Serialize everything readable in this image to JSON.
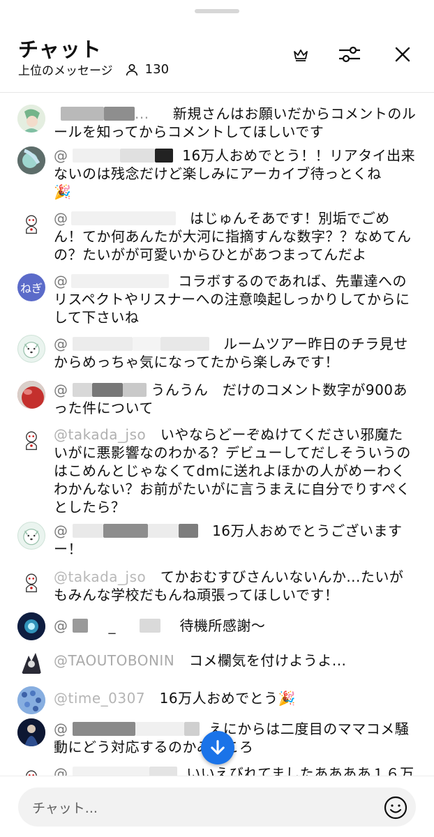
{
  "header": {
    "title": "チャット",
    "sort_label": "上位のメッセージ",
    "viewer_count": "130"
  },
  "icons": {
    "crown": "crown-icon",
    "tune": "tune-icon",
    "close": "close-icon",
    "person": "person-icon",
    "arrow_down": "arrow-down-icon",
    "emoji": "smiley-icon"
  },
  "colors": {
    "accent": "#1a73e8",
    "avatar_negi": "#5b6bc9"
  },
  "messages": [
    {
      "author": "",
      "text": "新規さんはお願いだからコメントのルールを知ってからコメントしてほしいです"
    },
    {
      "author": "@",
      "text": "16万人おめでとう！！リアタイ出来ないのは残念だけど楽しみにアーカイブ待っとくね",
      "emoji": "🎉"
    },
    {
      "author": "@",
      "text": "はじゅんそあです！別垢でごめん！てか何あんたが大河に指摘すんな数字？？なめてんの？たいがが可愛いからひとがあつまってんだよ"
    },
    {
      "author": "@",
      "avatar_text": "ねぎ",
      "text": "コラボするのであれば、先輩達へのリスペクトやリスナーへの注意喚起しっかりしてからにして下さいね"
    },
    {
      "author": "@",
      "text": "ルームツアー昨日のチラ見せからめっちゃ気になってたから楽しみです！"
    },
    {
      "author": "@",
      "text": "うんうん　だけのコメント数字が900あった件について"
    },
    {
      "author": "@takada_jso",
      "text": "いやならどーぞぬけてください邪魔たいがに悪影響なのわかる？デビューしてだしそういうのはこめんとじゃなくてdmに送れよほかの人がめーわくわかんない？お前がたいがに言うまえに自分でりすぺくとしたら？"
    },
    {
      "author": "@",
      "text": "16万人おめでとうございますー！"
    },
    {
      "author": "@takada_jso",
      "text": "てかおむすびさんいないんか...たいがもみんな学校だもんね頑張ってほしいです！"
    },
    {
      "author": "@",
      "text": "待機所感謝〜"
    },
    {
      "author": "@TAOUTOBONIN",
      "text": "コメ欄気を付けようよ..."
    },
    {
      "author": "@time_0307",
      "text": "16万人おめでとう",
      "emoji": "🎉"
    },
    {
      "author": "@",
      "text": "えにからは二度目のママコメ騒動にどう対応するのかみどころ"
    },
    {
      "author": "@",
      "text": "いいえびれてましたああああ１６万"
    }
  ],
  "input": {
    "placeholder": "チャット..."
  }
}
